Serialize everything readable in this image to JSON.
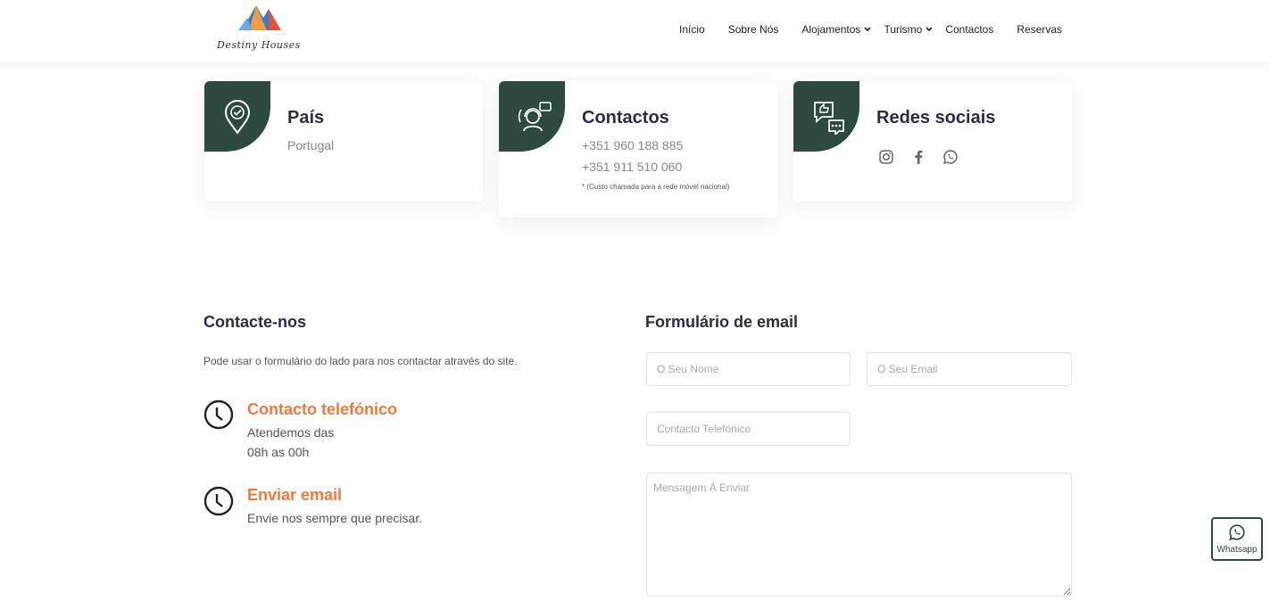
{
  "header": {
    "logo_text": "Destiny Houses",
    "nav": [
      {
        "label": "Início",
        "dropdown": false
      },
      {
        "label": "Sobre Nós",
        "dropdown": false
      },
      {
        "label": "Alojamentos",
        "dropdown": true
      },
      {
        "label": "Turismo",
        "dropdown": true
      },
      {
        "label": "Contactos",
        "dropdown": false
      },
      {
        "label": "Reservas",
        "dropdown": false
      }
    ]
  },
  "cards": {
    "country": {
      "title": "País",
      "value": "Portugal"
    },
    "contacts": {
      "title": "Contactos",
      "phone1": "+351 960 188 885",
      "phone2": "+351 911 510 060",
      "note": "* (Custo chamada para a rede móvel nacional)"
    },
    "social": {
      "title": "Redes sociais",
      "icons": [
        "instagram-icon",
        "facebook-icon",
        "whatsapp-icon"
      ]
    }
  },
  "contact": {
    "title": "Contacte-nos",
    "intro": "Pode usar o formulário do lado para nos contactar através do site.",
    "phone": {
      "title": "Contacto telefónico",
      "line1": "Atendemos das",
      "line2": "08h as 00h"
    },
    "email": {
      "title": "Enviar email",
      "line1": "Envie nos sempre que precisar."
    }
  },
  "form": {
    "title": "Formulário de email",
    "name_placeholder": "O Seu Nome",
    "email_placeholder": "O Seu Email",
    "phone_placeholder": "Contacto Telefónico",
    "message_placeholder": "Mensagem À Enviar"
  },
  "whatsapp_float": {
    "label": "Whatsapp"
  },
  "colors": {
    "primary": "#2c4a40",
    "accent": "#f07a3d",
    "text": "#2b2d42"
  }
}
